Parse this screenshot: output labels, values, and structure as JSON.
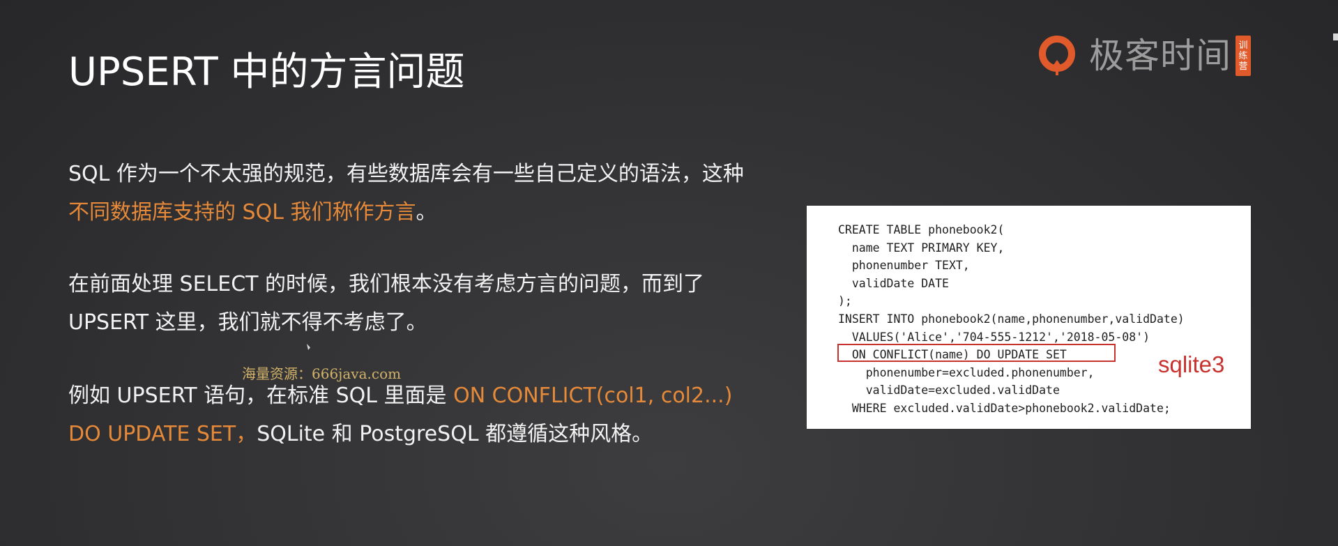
{
  "slide": {
    "title": "UPSERT 中的方言问题"
  },
  "logo": {
    "text": "极客时间",
    "badge": [
      "训",
      "练",
      "营"
    ],
    "colors": {
      "ring": "#e05a2b",
      "text": "#9c9c9c"
    }
  },
  "paragraphs": [
    {
      "segments": [
        {
          "text": "SQL 作为一个不太强的规范，有些数据库会有一些自己定义的语法，这种",
          "highlight": false
        },
        {
          "text": "不同数据库支持的 SQL 我们称作方言",
          "highlight": true
        },
        {
          "text": "。",
          "highlight": false
        }
      ]
    },
    {
      "segments": [
        {
          "text": "在前面处理 SELECT 的时候，我们根本没有考虑方言的问题，而到了 UPSERT 这里，我们就不得不考虑了。",
          "highlight": false
        }
      ]
    },
    {
      "segments": [
        {
          "text": "例如 UPSERT 语句，在标准 SQL 里面是 ",
          "highlight": false
        },
        {
          "text": "ON CONFLICT(col1, col2...) DO UPDATE SET，",
          "highlight": true
        },
        {
          "text": "SQLite 和 PostgreSQL 都遵循这种风格。",
          "highlight": false
        }
      ]
    }
  ],
  "watermark": "海量资源：666java.com",
  "code_example": {
    "lines": [
      "CREATE TABLE phonebook2(",
      "  name TEXT PRIMARY KEY,",
      "  phonenumber TEXT,",
      "  validDate DATE",
      ");",
      "INSERT INTO phonebook2(name,phonenumber,validDate)",
      "  VALUES('Alice','704-555-1212','2018-05-08')",
      "  ON CONFLICT(name) DO UPDATE SET",
      "    phonenumber=excluded.phonenumber,",
      "    validDate=excluded.validDate",
      "  WHERE excluded.validDate>phonebook2.validDate;"
    ],
    "annotation": "sqlite3",
    "highlighted_line_index": 7
  },
  "colors": {
    "accent": "#e68a3a",
    "annotation": "#c8322e",
    "text": "#f2f2f2"
  }
}
